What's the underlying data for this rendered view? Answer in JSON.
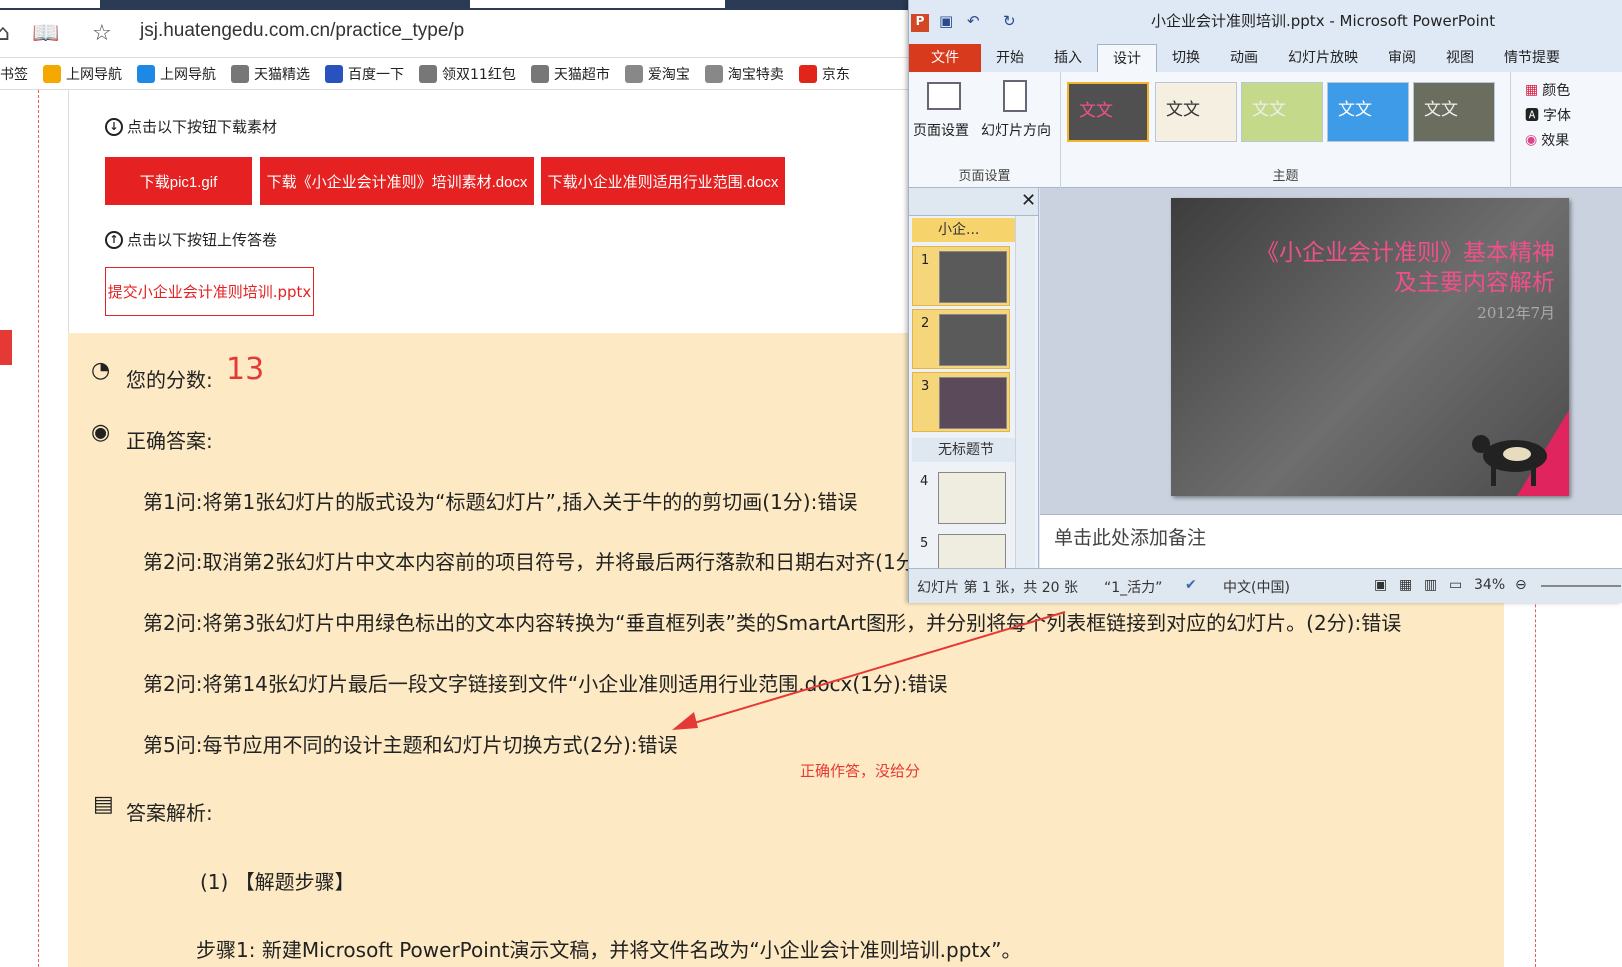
{
  "browser": {
    "url": "jsj.huatengedu.com.cn/practice_type/p",
    "bookmarks": [
      {
        "label": "书签",
        "icon": "bookmark-icon",
        "color": "#666666"
      },
      {
        "label": "上网导航",
        "icon": "nav-plus-icon",
        "color": "#f5a800"
      },
      {
        "label": "上网导航",
        "icon": "ie-icon",
        "color": "#1e88e5"
      },
      {
        "label": "天猫精选",
        "icon": "tmall-icon",
        "color": "#777777"
      },
      {
        "label": "百度一下",
        "icon": "baidu-paw-icon",
        "color": "#2a52be"
      },
      {
        "label": "领双11红包",
        "icon": "tmall-icon",
        "color": "#777777"
      },
      {
        "label": "天猫超市",
        "icon": "tmall-icon",
        "color": "#777777"
      },
      {
        "label": "爱淘宝",
        "icon": "globe-icon",
        "color": "#888888"
      },
      {
        "label": "淘宝特卖",
        "icon": "globe-icon",
        "color": "#888888"
      },
      {
        "label": "京东",
        "icon": "jd-icon",
        "color": "#e1251b"
      }
    ]
  },
  "page": {
    "download_label": "点击以下按钮下载素材",
    "download_buttons": [
      "下载pic1.gif",
      "下载《小企业会计准则》培训素材.docx",
      "下载小企业准则适用行业范围.docx"
    ],
    "upload_label": "点击以下按钮上传答卷",
    "upload_button": "提交小企业会计准则培训.pptx",
    "score_label": "您的分数:",
    "score_value": "13",
    "answer_heading": "正确答案:",
    "answers": [
      "第1问:将第1张幻灯片的版式设为“标题幻灯片”,插入关于牛的的剪切画(1分):错误",
      "第2问:取消第2张幻灯片中文本内容前的项目符号，并将最后两行落款和日期右对齐(1分",
      "第2问:将第3张幻灯片中用绿色标出的文本内容转换为“垂直框列表”类的SmartArt图形，并分别将每个列表框链接到对应的幻灯片。(2分):错误",
      "第2问:将第14张幻灯片最后一段文字链接到文件“小企业准则适用行业范围.docx(1分):错误",
      "第5问:每节应用不同的设计主题和幻灯片切换方式(2分):错误"
    ],
    "annotation": "正确作答，没给分",
    "analysis_heading": "答案解析:",
    "step_heading": "(1) 【解题步骤】",
    "step1": "步骤1: 新建Microsoft PowerPoint演示文稿，并将文件名改为“小企业会计准则培训.pptx”。"
  },
  "ppt": {
    "title": "小企业会计准则培训.pptx - Microsoft PowerPoint",
    "tabs": [
      "文件",
      "开始",
      "插入",
      "设计",
      "切换",
      "动画",
      "幻灯片放映",
      "审阅",
      "视图",
      "情节提要"
    ],
    "active_tab": "设计",
    "page_setup": "页面设置",
    "slide_orientation": "幻灯片方向",
    "group_page_setup": "页面设置",
    "group_themes": "主题",
    "theme_text": "文文",
    "colors": "颜色",
    "fonts": "字体",
    "effects": "效果",
    "section1": "小企...",
    "section2": "无标题节",
    "slide_numbers": [
      "1",
      "2",
      "3",
      "4",
      "5"
    ],
    "slide_title_line1": "《小企业会计准则》基本精神",
    "slide_title_line2": "及主要内容解析",
    "slide_date": "2012年7月",
    "notes_placeholder": "单击此处添加备注",
    "status_slide": "幻灯片 第 1 张，共 20 张",
    "status_theme": "“1_活力”",
    "status_lang": "中文(中国)",
    "status_zoom": "34%"
  }
}
